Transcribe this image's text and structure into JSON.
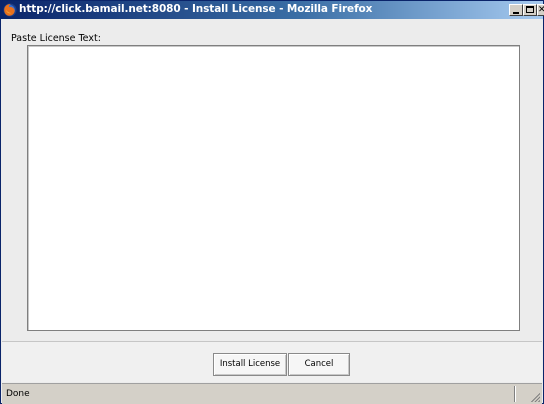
{
  "window": {
    "title": "http://click.bamail.net:8080 - Install License - Mozilla Firefox",
    "app_icon": "firefox-icon",
    "controls": {
      "minimize": "minimize-icon",
      "maximize": "maximize-icon",
      "close": "close-icon"
    }
  },
  "form": {
    "label": "Paste License Text:",
    "textarea_value": ""
  },
  "buttons": {
    "install_label": "Install License",
    "cancel_label": "Cancel"
  },
  "statusbar": {
    "text": "Done"
  },
  "colors": {
    "titlebar_start": "#0a246a",
    "titlebar_end": "#a6caf0",
    "dialog_bg": "#ececec",
    "statusbar_bg": "#d4d0c8"
  }
}
